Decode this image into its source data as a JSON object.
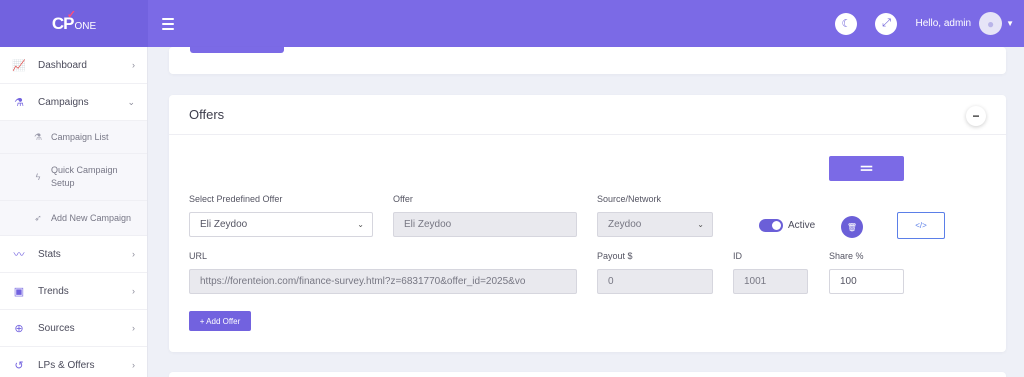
{
  "brand": {
    "logo_text": "CP",
    "logo_suffix": "ONE"
  },
  "topbar": {
    "theme_icon": "moon-icon",
    "fullscreen_icon": "expand-icon",
    "greeting": "Hello, admin",
    "avatar_icon": "user-icon"
  },
  "sidebar": {
    "items": [
      {
        "label": "Dashboard",
        "icon": "chart-line-icon"
      },
      {
        "label": "Campaigns",
        "icon": "flask-icon"
      },
      {
        "label": "Stats",
        "icon": "graph-icon"
      },
      {
        "label": "Trends",
        "icon": "briefcase-icon"
      },
      {
        "label": "Sources",
        "icon": "globe-icon"
      },
      {
        "label": "LPs & Offers",
        "icon": "history-icon"
      }
    ],
    "sub_items": [
      {
        "label": "Campaign List",
        "icon": "flask-icon"
      },
      {
        "label_line1": "Quick Campaign",
        "label_line2": "Setup",
        "icon": "bolt-icon"
      },
      {
        "label": "Add New Campaign",
        "icon": "paper-plane-icon"
      }
    ]
  },
  "offers": {
    "title": "Offers",
    "labels": {
      "predefined": "Select Predefined Offer",
      "offer": "Offer",
      "source": "Source/Network",
      "url": "URL",
      "payout": "Payout $",
      "id": "ID",
      "share": "Share %"
    },
    "values": {
      "predefined": "Eli Zeydoo",
      "offer": "Eli Zeydoo",
      "source": "Zeydoo",
      "url": "https://forenteion.com/finance-survey.html?z=6831770&offer_id=2025&vo",
      "payout": "0",
      "id": "1001",
      "share": "100"
    },
    "active_label": "Active",
    "active": true,
    "add_offer_label": "+ Add Offer",
    "accent_color": "#7b6ae6"
  }
}
